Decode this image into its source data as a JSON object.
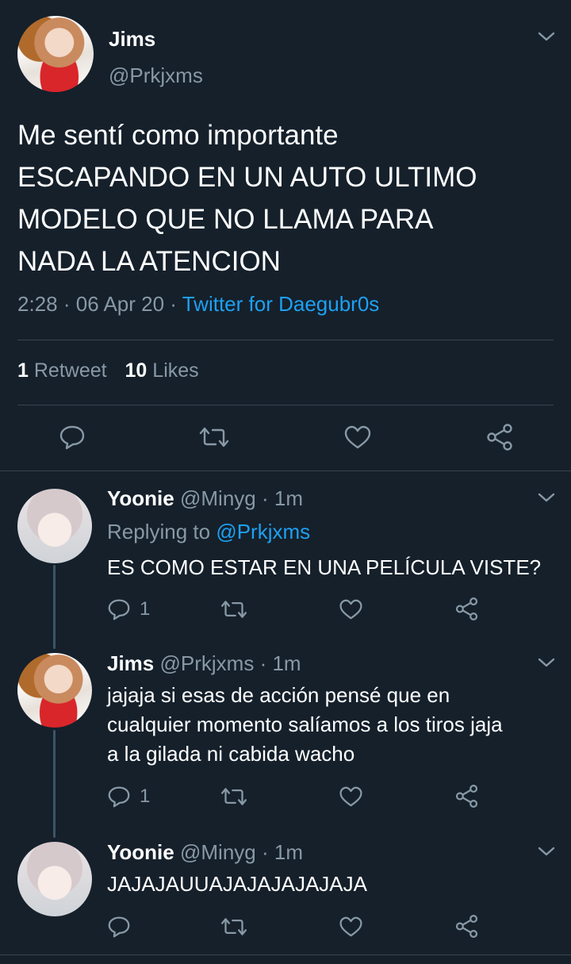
{
  "main_tweet": {
    "name": "Jims",
    "handle": "@Prkjxms",
    "text_lines": [
      "Me sentí como importante",
      "ESCAPANDO EN UN AUTO ULTIMO",
      "MODELO QUE NO LLAMA PARA",
      "NADA LA ATENCION"
    ],
    "time": "2:28",
    "date": "06 Apr 20",
    "source": "Twitter for Daegubr0s",
    "retweets_count": "1",
    "retweets_label": "Retweet",
    "likes_count": "10",
    "likes_label": "Likes"
  },
  "replies": [
    {
      "name": "Yoonie",
      "handle": "@Minyg",
      "time": "1m",
      "replying_label": "Replying to",
      "replying_to": "@Prkjxms",
      "text_lines": [
        "ES COMO ESTAR EN UNA PELÍCULA VISTE?"
      ],
      "reply_count": "1"
    },
    {
      "name": "Jims",
      "handle": "@Prkjxms",
      "time": "1m",
      "text_lines": [
        "jajaja si esas de acción pensé que en",
        "cualquier momento salíamos a los tiros jaja",
        "a la gilada ni cabida wacho"
      ],
      "reply_count": "1"
    },
    {
      "name": "Yoonie",
      "handle": "@Minyg",
      "time": "1m",
      "text_lines": [
        "JAJAJAUUAJAJAJAJAJAJA"
      ],
      "reply_count": ""
    }
  ],
  "separator": "·",
  "icons": {
    "reply": "comment-icon",
    "retweet": "retweet-icon",
    "like": "heart-icon",
    "share": "share-icon",
    "more": "chevron-down-icon"
  },
  "colors": {
    "background": "#15202b",
    "muted": "#8899a6",
    "link": "#1da1f2",
    "divider": "#38444d"
  }
}
